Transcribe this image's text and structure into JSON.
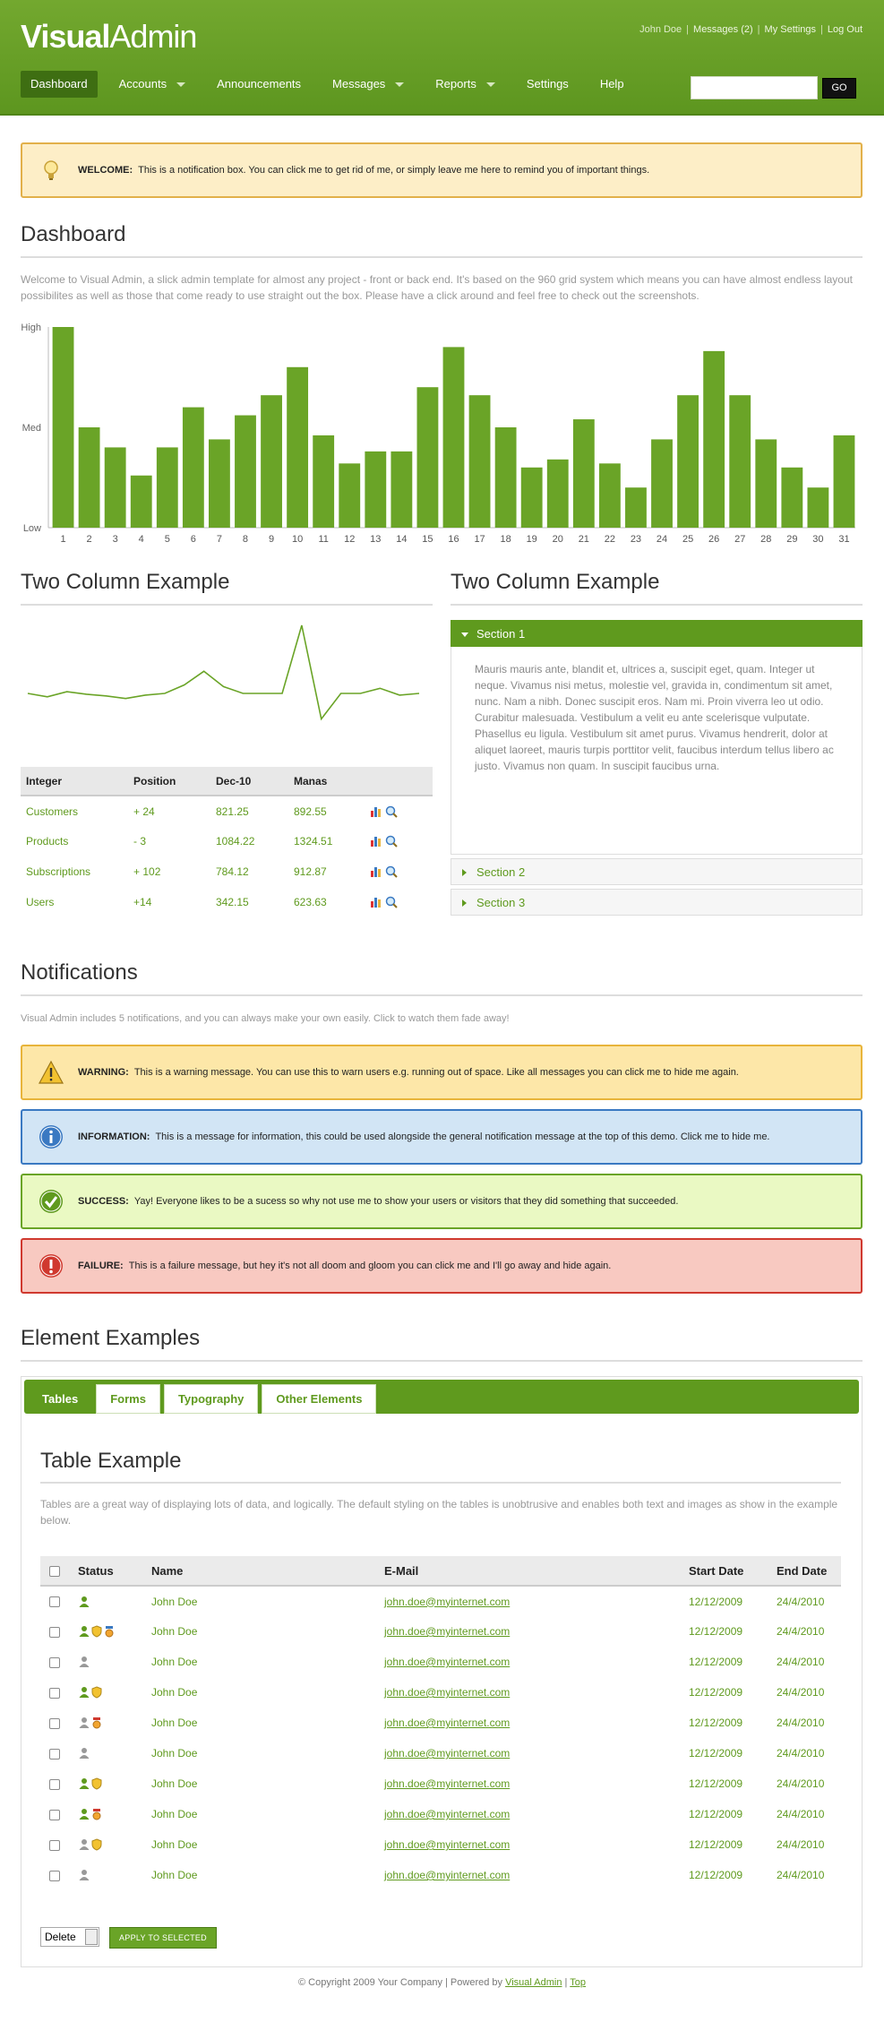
{
  "header": {
    "logo_bold": "Visual",
    "logo_light": "Admin",
    "user_name": "John Doe",
    "messages_label": "Messages (2)",
    "settings_label": "My Settings",
    "logout_label": "Log Out",
    "nav": [
      {
        "label": "Dashboard",
        "active": true,
        "caret": false
      },
      {
        "label": "Accounts",
        "active": false,
        "caret": true
      },
      {
        "label": "Announcements",
        "active": false,
        "caret": false
      },
      {
        "label": "Messages",
        "active": false,
        "caret": true
      },
      {
        "label": "Reports",
        "active": false,
        "caret": true
      },
      {
        "label": "Settings",
        "active": false,
        "caret": false
      },
      {
        "label": "Help",
        "active": false,
        "caret": false
      }
    ],
    "search_value": "",
    "go_label": "GO"
  },
  "welcome": {
    "title": "WELCOME:",
    "text": "This is a notification box. You can click me to get rid of me, or simply leave me here to remind you of important things."
  },
  "dashboard": {
    "heading": "Dashboard",
    "intro": "Welcome to Visual Admin, a slick admin template for almost any project - front or back end. It's based on the 960 grid system which means you can have almost endless layout possibilites as well as those that come ready to use straight out the box. Please have a click around and feel free to check out the screenshots."
  },
  "chart_data": [
    {
      "type": "bar",
      "categories": [
        "1",
        "2",
        "3",
        "4",
        "5",
        "6",
        "7",
        "8",
        "9",
        "10",
        "11",
        "12",
        "13",
        "14",
        "15",
        "16",
        "17",
        "18",
        "19",
        "20",
        "21",
        "22",
        "23",
        "24",
        "25",
        "26",
        "27",
        "28",
        "29",
        "30",
        "31"
      ],
      "values": [
        100,
        50,
        40,
        26,
        40,
        60,
        44,
        56,
        66,
        80,
        46,
        32,
        38,
        38,
        70,
        90,
        66,
        50,
        30,
        34,
        54,
        32,
        20,
        44,
        66,
        88,
        66,
        44,
        30,
        20,
        46
      ],
      "ytick_labels": [
        "Low",
        "Med",
        "High"
      ],
      "ylim": [
        0,
        100
      ],
      "color": "#6aa427"
    },
    {
      "type": "line",
      "x": [
        1,
        2,
        3,
        4,
        5,
        6,
        7,
        8,
        9,
        10,
        11,
        12,
        13,
        14,
        15,
        16,
        17,
        18,
        19,
        20,
        21
      ],
      "values": [
        40,
        36,
        42,
        39,
        37,
        34,
        38,
        40,
        50,
        66,
        48,
        40,
        40,
        40,
        120,
        10,
        40,
        40,
        46,
        38,
        40
      ],
      "color": "#6aa427"
    }
  ],
  "twocol_left": {
    "heading": "Two Column Example",
    "columns": [
      "Integer",
      "Position",
      "Dec-10",
      "Manas",
      ""
    ],
    "rows": [
      {
        "name": "Customers",
        "position": "+ 24",
        "dec": "821.25",
        "manas": "892.55"
      },
      {
        "name": "Products",
        "position": "- 3",
        "dec": "1084.22",
        "manas": "1324.51"
      },
      {
        "name": "Subscriptions",
        "position": "+ 102",
        "dec": "784.12",
        "manas": "912.87"
      },
      {
        "name": "Users",
        "position": "+14",
        "dec": "342.15",
        "manas": "623.63"
      }
    ]
  },
  "twocol_right": {
    "heading": "Two Column Example",
    "sections": [
      "Section 1",
      "Section 2",
      "Section 3"
    ],
    "section1_text": "Mauris mauris ante, blandit et, ultrices a, suscipit eget, quam. Integer ut neque. Vivamus nisi metus, molestie vel, gravida in, condimentum sit amet, nunc. Nam a nibh. Donec suscipit eros. Nam mi. Proin viverra leo ut odio. Curabitur malesuada. Vestibulum a velit eu ante scelerisque vulputate. Phasellus eu ligula. Vestibulum sit amet purus. Vivamus hendrerit, dolor at aliquet laoreet, mauris turpis porttitor velit, faucibus interdum tellus libero ac justo. Vivamus non quam. In suscipit faucibus urna."
  },
  "notifications": {
    "heading": "Notifications",
    "intro": "Visual Admin includes 5 notifications, and you can always make your own easily. Click to watch them fade away!",
    "items": [
      {
        "kind": "warning",
        "title": "WARNING:",
        "text": "This is a warning message. You can use this to warn users e.g. running out of space. Like all messages you can click me to hide me again.",
        "bg": "#fde7a8",
        "border": "#e8b43a"
      },
      {
        "kind": "information",
        "title": "INFORMATION:",
        "text": "This is a message for information, this could be used alongside the general notification message at the top of this demo. Click me to hide me.",
        "bg": "#d2e5f5",
        "border": "#3a79c2"
      },
      {
        "kind": "success",
        "title": "SUCCESS:",
        "text": "Yay! Everyone likes to be a sucess so why not use me to show your users or visitors that they did something that succeeded.",
        "bg": "#eaf9c3",
        "border": "#6aa427"
      },
      {
        "kind": "failure",
        "title": "FAILURE:",
        "text": "This is a failure message, but hey it's not all doom and gloom you can click me and I'll go away and hide again.",
        "bg": "#f8c9c1",
        "border": "#d0392f"
      }
    ]
  },
  "elements": {
    "heading": "Element Examples",
    "tabs": [
      "Tables",
      "Forms",
      "Typography",
      "Other Elements"
    ],
    "table_heading": "Table Example",
    "table_intro": "Tables are a great way of displaying lots of data, and logically. The default styling on the tables is unobtrusive and enables both text and images as show in the example below.",
    "columns": [
      "Status",
      "Name",
      "E-Mail",
      "Start Date",
      "End Date"
    ],
    "rows": [
      {
        "status": [
          "user-green"
        ],
        "name": "John Doe",
        "email": "john.doe@myinternet.com",
        "start": "12/12/2009",
        "end": "24/4/2010"
      },
      {
        "status": [
          "user-green",
          "shield-yellow",
          "badge-orange"
        ],
        "name": "John Doe",
        "email": "john.doe@myinternet.com",
        "start": "12/12/2009",
        "end": "24/4/2010"
      },
      {
        "status": [
          "user-grey"
        ],
        "name": "John Doe",
        "email": "john.doe@myinternet.com",
        "start": "12/12/2009",
        "end": "24/4/2010"
      },
      {
        "status": [
          "user-green",
          "shield-yellow"
        ],
        "name": "John Doe",
        "email": "john.doe@myinternet.com",
        "start": "12/12/2009",
        "end": "24/4/2010"
      },
      {
        "status": [
          "user-grey",
          "badge-red"
        ],
        "name": "John Doe",
        "email": "john.doe@myinternet.com",
        "start": "12/12/2009",
        "end": "24/4/2010"
      },
      {
        "status": [
          "user-grey"
        ],
        "name": "John Doe",
        "email": "john.doe@myinternet.com",
        "start": "12/12/2009",
        "end": "24/4/2010"
      },
      {
        "status": [
          "user-green",
          "shield-yellow"
        ],
        "name": "John Doe",
        "email": "john.doe@myinternet.com",
        "start": "12/12/2009",
        "end": "24/4/2010"
      },
      {
        "status": [
          "user-green",
          "badge-red"
        ],
        "name": "John Doe",
        "email": "john.doe@myinternet.com",
        "start": "12/12/2009",
        "end": "24/4/2010"
      },
      {
        "status": [
          "user-grey",
          "shield-yellow"
        ],
        "name": "John Doe",
        "email": "john.doe@myinternet.com",
        "start": "12/12/2009",
        "end": "24/4/2010"
      },
      {
        "status": [
          "user-grey"
        ],
        "name": "John Doe",
        "email": "john.doe@myinternet.com",
        "start": "12/12/2009",
        "end": "24/4/2010"
      }
    ],
    "bulk_action": "Delete",
    "apply_label": "APPLY TO SELECTED"
  },
  "footer": {
    "copyright": "© Copyright 2009 Your Company | Powered by ",
    "powered": "Visual Admin",
    "sep": " | ",
    "top": "Top"
  }
}
